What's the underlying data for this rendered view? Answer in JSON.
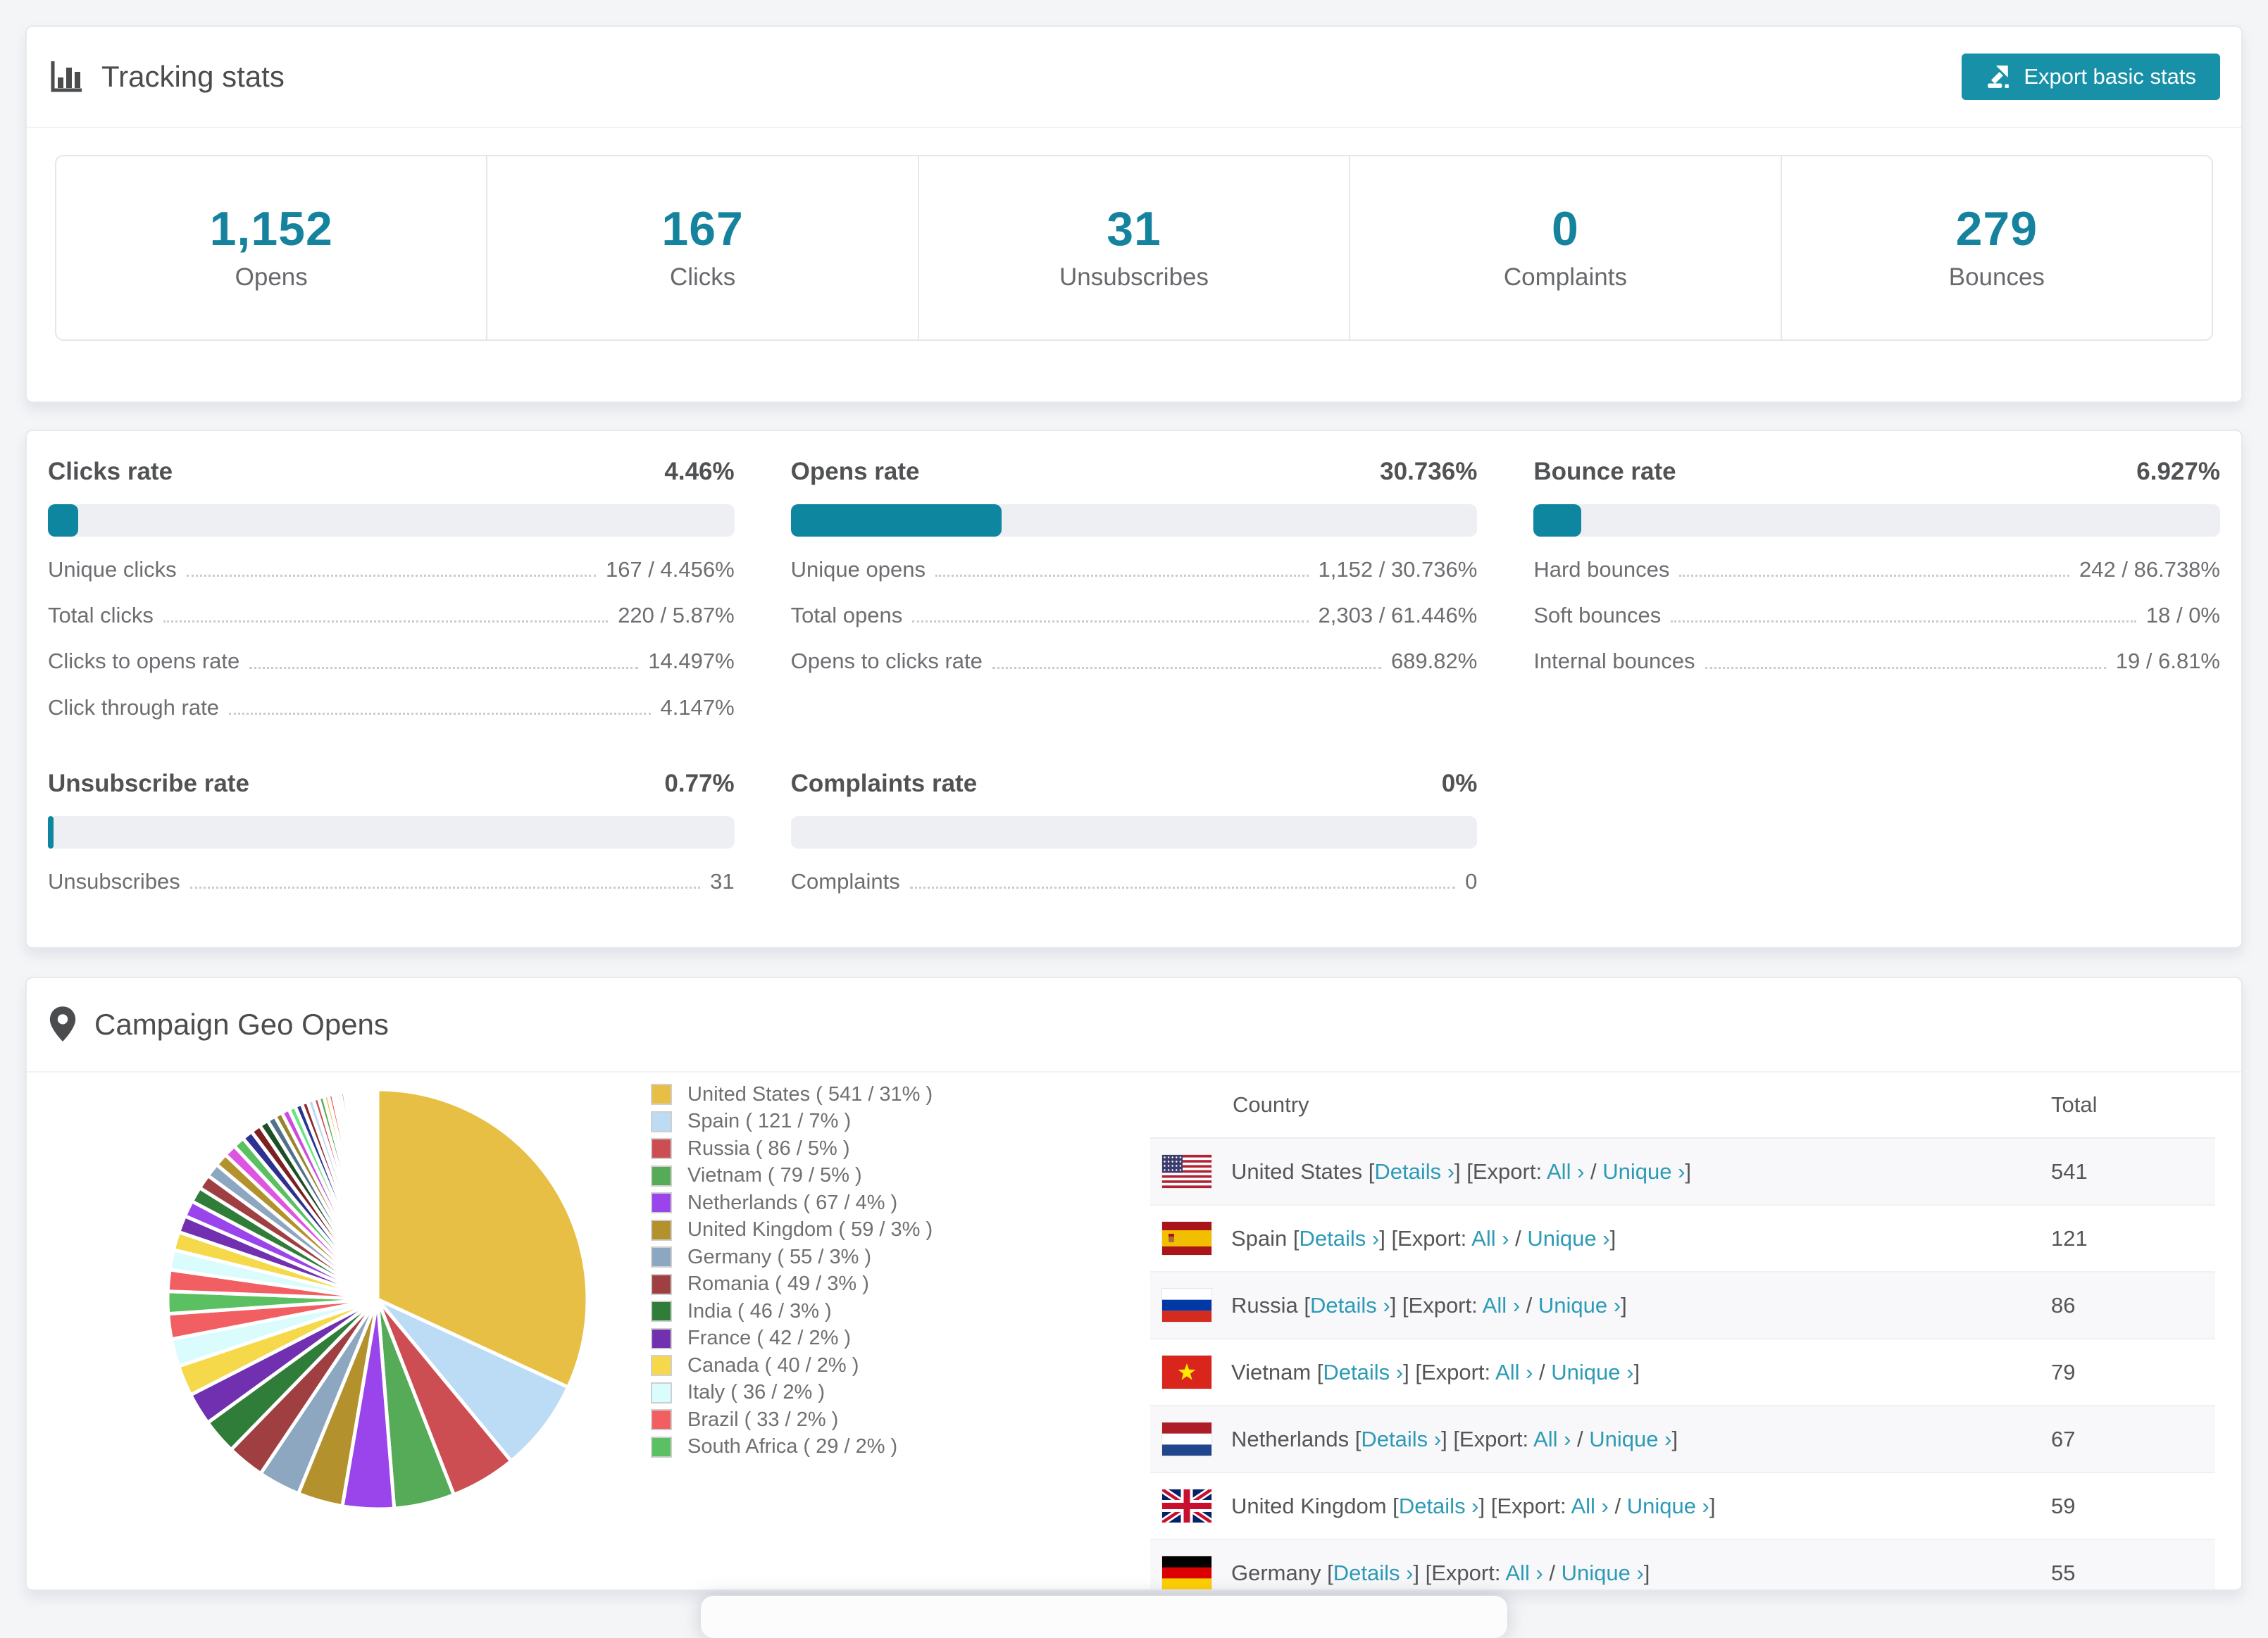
{
  "tracking": {
    "title": "Tracking stats",
    "export_button": "Export basic stats",
    "accent_color": "#1790a8",
    "stats": [
      {
        "value": "1,152",
        "label": "Opens"
      },
      {
        "value": "167",
        "label": "Clicks"
      },
      {
        "value": "31",
        "label": "Unsubscribes"
      },
      {
        "value": "0",
        "label": "Complaints"
      },
      {
        "value": "279",
        "label": "Bounces"
      }
    ]
  },
  "rates": {
    "bar_color": "#0e86a0",
    "blocks": [
      {
        "title": "Clicks rate",
        "value": "4.46%",
        "percent": 4.46,
        "rows": [
          [
            "Unique clicks",
            "167 / 4.456%"
          ],
          [
            "Total clicks",
            "220 / 5.87%"
          ],
          [
            "Clicks to opens rate",
            "14.497%"
          ],
          [
            "Click through rate",
            "4.147%"
          ]
        ]
      },
      {
        "title": "Opens rate",
        "value": "30.736%",
        "percent": 30.736,
        "rows": [
          [
            "Unique opens",
            "1,152 / 30.736%"
          ],
          [
            "Total opens",
            "2,303 / 61.446%"
          ],
          [
            "Opens to clicks rate",
            "689.82%"
          ]
        ]
      },
      {
        "title": "Bounce rate",
        "value": "6.927%",
        "percent": 6.927,
        "rows": [
          [
            "Hard bounces",
            "242 / 86.738%"
          ],
          [
            "Soft bounces",
            "18 / 0%"
          ],
          [
            "Internal bounces",
            "19 / 6.81%"
          ]
        ]
      },
      {
        "title": "Unsubscribe rate",
        "value": "0.77%",
        "percent": 0.77,
        "rows": [
          [
            "Unsubscribes",
            "31"
          ]
        ]
      },
      {
        "title": "Complaints rate",
        "value": "0%",
        "percent": 0,
        "rows": [
          [
            "Complaints",
            "0"
          ]
        ]
      }
    ]
  },
  "geo": {
    "title": "Campaign Geo Opens",
    "table": {
      "headers": [
        "Country",
        "Total"
      ],
      "links": {
        "details": "Details ›",
        "export_prefix": "[Export: ",
        "all": "All ›",
        "unique": "Unique ›",
        "separator": " / ",
        "open_bracket": " [",
        "close_bracket": "]"
      },
      "rows": [
        {
          "country": "United States",
          "total": "541",
          "flag": "us",
          "partial": false
        },
        {
          "country": "Spain",
          "total": "121",
          "flag": "es",
          "partial": false
        },
        {
          "country": "Russia",
          "total": "86",
          "flag": "ru",
          "partial": false
        },
        {
          "country": "Vietnam",
          "total": "79",
          "flag": "vn",
          "partial": false
        },
        {
          "country": "Netherlands",
          "total": "67",
          "flag": "nl",
          "partial": false
        },
        {
          "country": "United Kingdom",
          "total": "59",
          "flag": "gb",
          "partial": false
        },
        {
          "country": "Germany",
          "total": "55",
          "flag": "de",
          "partial": true
        }
      ]
    }
  },
  "chart_data": {
    "type": "pie",
    "title": "Campaign Geo Opens",
    "unit": "opens",
    "start_angle_deg": -90,
    "direction": "clockwise",
    "legend_position": "right",
    "series": [
      {
        "label": "United States",
        "value": 541,
        "pct": "31%",
        "color": "#e8bf45"
      },
      {
        "label": "Spain",
        "value": 121,
        "pct": "7%",
        "color": "#bcdcf5"
      },
      {
        "label": "Russia",
        "value": 86,
        "pct": "5%",
        "color": "#cc4d52"
      },
      {
        "label": "Vietnam",
        "value": 79,
        "pct": "5%",
        "color": "#55ab57"
      },
      {
        "label": "Netherlands",
        "value": 67,
        "pct": "4%",
        "color": "#9a44ec"
      },
      {
        "label": "United Kingdom",
        "value": 59,
        "pct": "3%",
        "color": "#b3922e"
      },
      {
        "label": "Germany",
        "value": 55,
        "pct": "3%",
        "color": "#8da7c0"
      },
      {
        "label": "Romania",
        "value": 49,
        "pct": "3%",
        "color": "#a03f42"
      },
      {
        "label": "India",
        "value": 46,
        "pct": "3%",
        "color": "#2f7d38"
      },
      {
        "label": "France",
        "value": 42,
        "pct": "2%",
        "color": "#7030b0"
      },
      {
        "label": "Canada",
        "value": 40,
        "pct": "2%",
        "color": "#f6d94a"
      },
      {
        "label": "Italy",
        "value": 36,
        "pct": "2%",
        "color": "#dbfcfd"
      },
      {
        "label": "Brazil",
        "value": 33,
        "pct": "2%",
        "color": "#f15f63"
      },
      {
        "label": "South Africa",
        "value": 29,
        "pct": "2%",
        "color": "#5ac061"
      }
    ],
    "other_slices": {
      "note": "unlabeled small slices continuing clockwise",
      "values": [
        28,
        26,
        24,
        22,
        21,
        20,
        19,
        18,
        17,
        16,
        15,
        14,
        13,
        12,
        11,
        10,
        10,
        9,
        9,
        8,
        8,
        7,
        7,
        6,
        6,
        5,
        5,
        5,
        4,
        4,
        4,
        3,
        3,
        3,
        3,
        2,
        2,
        2,
        2,
        2,
        2,
        1,
        1,
        1,
        1,
        1,
        1,
        1
      ],
      "colors": [
        "#f15f63",
        "#dbfcfd",
        "#f6d94a",
        "#7030b0",
        "#9a44ec",
        "#2f7d38",
        "#a03f42",
        "#8da7c0",
        "#b3922e",
        "#dd55e0",
        "#5ac061",
        "#2e3192",
        "#7c2022",
        "#1d4f24",
        "#51718a",
        "#97842c",
        "#cb4ce0",
        "#66e584",
        "#283593",
        "#8c2b2e",
        "#bcdcf5",
        "#cc4d52",
        "#55ab57",
        "#e8bf45"
      ]
    }
  }
}
